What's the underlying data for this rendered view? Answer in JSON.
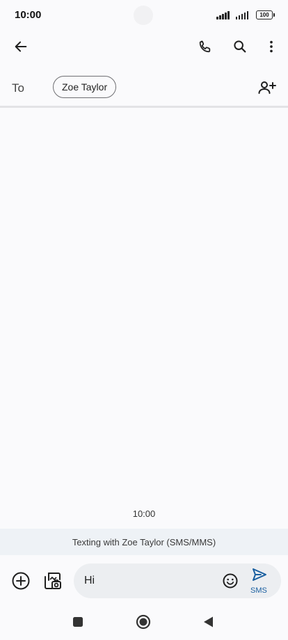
{
  "status_bar": {
    "time": "10:00",
    "battery": "100"
  },
  "app_bar": {
    "back_icon": "arrow-left-icon",
    "call_icon": "phone-icon",
    "search_icon": "search-icon",
    "more_icon": "more-vertical-icon"
  },
  "recipients": {
    "to_label": "To",
    "chips": [
      "Zoe Taylor"
    ],
    "add_icon": "add-person-icon"
  },
  "conversation": {
    "timestamp": "10:00",
    "banner": "Texting with Zoe Taylor (SMS/MMS)"
  },
  "composer": {
    "attach_icon": "plus-circle-icon",
    "gallery_icon": "gallery-icon",
    "message_text": "Hi",
    "emoji_icon": "emoji-icon",
    "send_icon": "send-icon",
    "send_label": "SMS",
    "accent_color": "#1a5fa0"
  },
  "nav_bar": {
    "recents_icon": "square-icon",
    "home_icon": "circle-icon",
    "back_icon": "triangle-back-icon"
  }
}
